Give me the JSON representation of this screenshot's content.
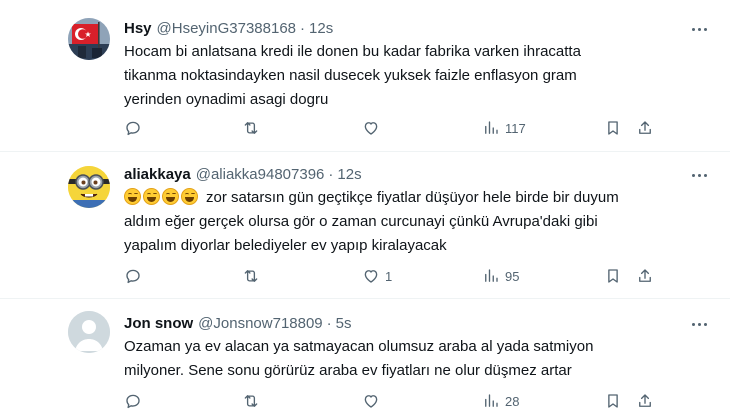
{
  "tweets": [
    {
      "name": "Hsy",
      "handle": "@HseyinG37388168",
      "dot": "·",
      "time": "12s",
      "avatar": "flag-avatar",
      "lines": [
        "Hocam bi anlatsana kredi ile donen bu kadar fabrika varken ihracatta",
        "tikanma noktasindayken nasil dusecek yuksek faizle enflasyon gram",
        "yerinden oynadimi asagi dogru"
      ],
      "reply_count": "",
      "retweet_count": "",
      "like_count": "",
      "view_count": "117"
    },
    {
      "name": "aliakkaya",
      "handle": "@aliakka94807396",
      "dot": "·",
      "time": "12s",
      "avatar": "minion-avatar",
      "emoji": "rolling-on-floor-laughing x4",
      "lines": [
        "zor satarsın gün geçtikçe fiyatlar düşüyor hele birde bir duyum",
        "aldım eğer gerçek olursa gör o zaman curcunayi çünkü Avrupa'daki gibi",
        "yapalım diyorlar belediyeler ev yapıp kiralayacak"
      ],
      "reply_count": "",
      "retweet_count": "",
      "like_count": "1",
      "view_count": "95"
    },
    {
      "name": "Jon snow",
      "handle": "@Jonsnow718809",
      "dot": "·",
      "time": "5s",
      "avatar": "default-avatar",
      "lines": [
        "Ozaman ya ev alacan ya satmayacan olumsuz araba al yada satmiyon",
        "milyoner. Sene sonu görürüz araba ev fiyatları ne olur düşmez artar"
      ],
      "reply_count": "",
      "retweet_count": "",
      "like_count": "",
      "view_count": "28"
    }
  ],
  "colors": {
    "text": "#0f1419",
    "secondary": "#536471",
    "divider": "#eff3f4",
    "background": "#ffffff"
  },
  "icons": [
    "reply-icon",
    "retweet-icon",
    "like-icon",
    "views-icon",
    "bookmark-icon",
    "share-icon",
    "more-icon"
  ]
}
